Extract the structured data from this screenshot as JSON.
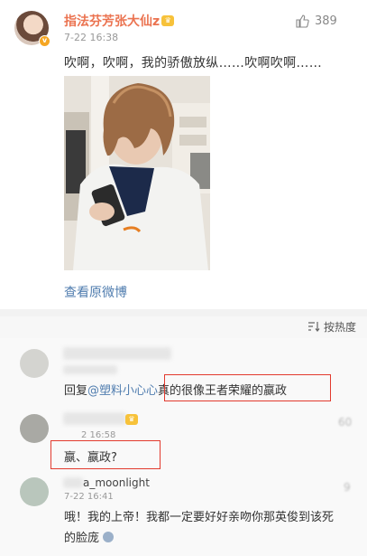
{
  "post": {
    "username": "指法芬芳张大仙z",
    "time": "7-22 16:38",
    "like_count": "389",
    "text": "吹啊，吹啊，我的骄傲放纵……吹啊吹啊……",
    "view_original": "查看原微博"
  },
  "sort": {
    "label": "按热度"
  },
  "comments": [
    {
      "reply_prefix": "回复",
      "mention": "@塑料小心心",
      "text": "真的很像王者荣耀的嬴政"
    },
    {
      "time": "2 16:58",
      "like_count": "60",
      "text": "嬴、嬴政?"
    },
    {
      "name": "a_moonlight",
      "time": "7-22 16:41",
      "like_count": "9",
      "text_line1": "哦！我的上帝！我都一定要好好亲吻你那英俊到该死",
      "text_line2": "的脸庞"
    }
  ],
  "colors": {
    "username": "#eb7350",
    "link": "#507daf",
    "highlight_box": "#e23a2e"
  }
}
